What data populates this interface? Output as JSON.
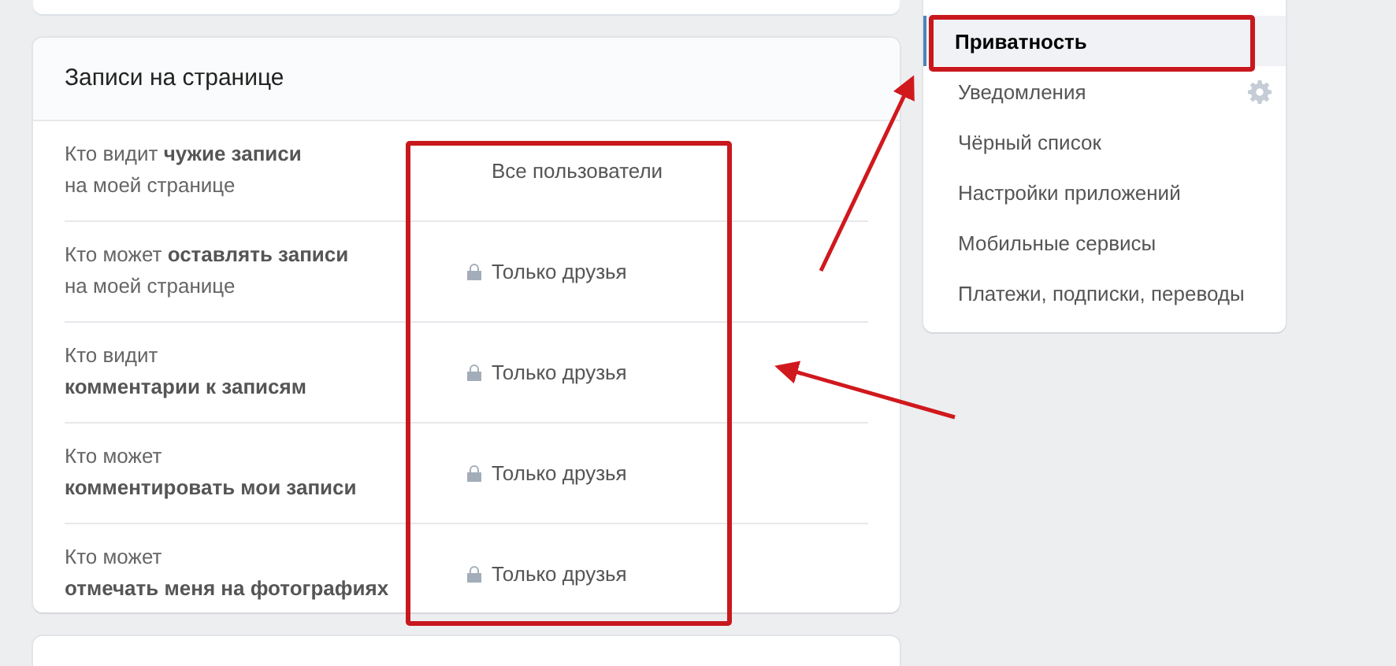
{
  "section": {
    "title": "Записи на странице",
    "rows": [
      {
        "label": [
          "Кто видит **чужие записи**",
          "на моей странице"
        ],
        "value": "Все пользователи",
        "locked": false
      },
      {
        "label": [
          "Кто может **оставлять записи**",
          "на моей странице"
        ],
        "value": "Только друзья",
        "locked": true
      },
      {
        "label": [
          "Кто видит",
          "**комментарии к записям**"
        ],
        "value": "Только друзья",
        "locked": true
      },
      {
        "label": [
          "Кто может",
          "**комментировать мои записи**"
        ],
        "value": "Только друзья",
        "locked": true
      },
      {
        "label": [
          "Кто может",
          "**отмечать меня на фотографиях**"
        ],
        "value": "Только друзья",
        "locked": true
      }
    ]
  },
  "menu": {
    "items": [
      {
        "label": "Приватность",
        "selected": true,
        "settings": false
      },
      {
        "label": "Уведомления",
        "selected": false,
        "settings": true
      },
      {
        "label": "Чёрный список",
        "selected": false,
        "settings": false
      },
      {
        "label": "Настройки приложений",
        "selected": false,
        "settings": false
      },
      {
        "label": "Мобильные сервисы",
        "selected": false,
        "settings": false
      },
      {
        "label": "Платежи, подписки, переводы",
        "selected": false,
        "settings": false
      }
    ]
  }
}
